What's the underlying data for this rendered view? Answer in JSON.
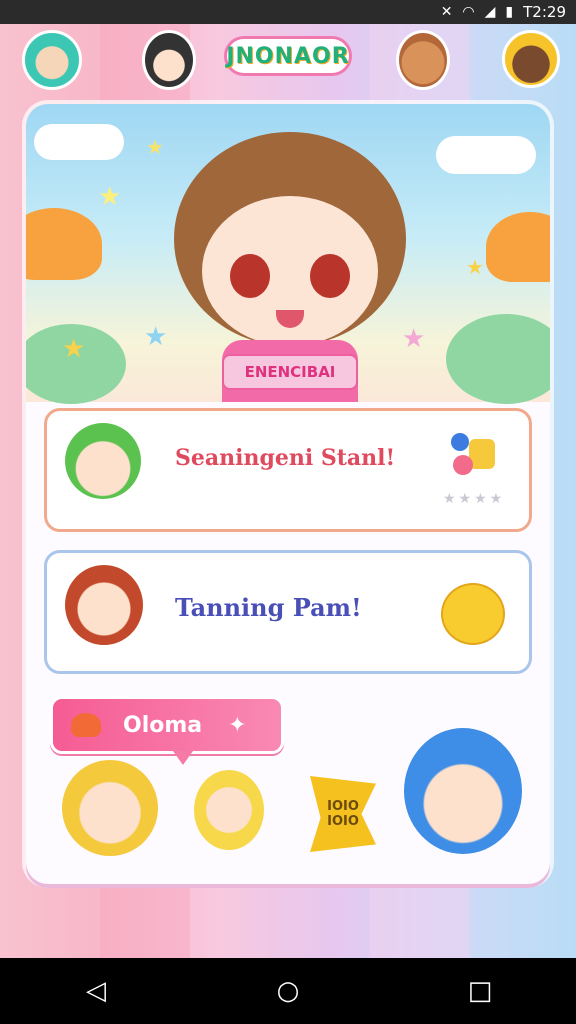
{
  "status_bar": {
    "icons": [
      "no-sim-icon",
      "wifi-icon",
      "signal-icon",
      "battery-icon"
    ],
    "time": "T2:29"
  },
  "header": {
    "logo_text": "JNONAOR"
  },
  "hero": {
    "banner_text": "ENENCIBAI"
  },
  "cards": [
    {
      "title": "Seaningeni Stanl!",
      "title_color": "#e04a5e",
      "rating_stars": 4
    },
    {
      "title": "Tanning Pam!",
      "title_color": "#4a4fb8"
    }
  ],
  "action_bubble": {
    "label": "Oloma"
  },
  "sticker": {
    "text": "IOIO IOIO"
  },
  "nav": {
    "back": "◁",
    "home": "○",
    "recents": "□"
  },
  "colors": {
    "accent_pink": "#f55c93",
    "card_border_orange": "#f2a98b",
    "card_border_blue": "#a9c6ea"
  }
}
